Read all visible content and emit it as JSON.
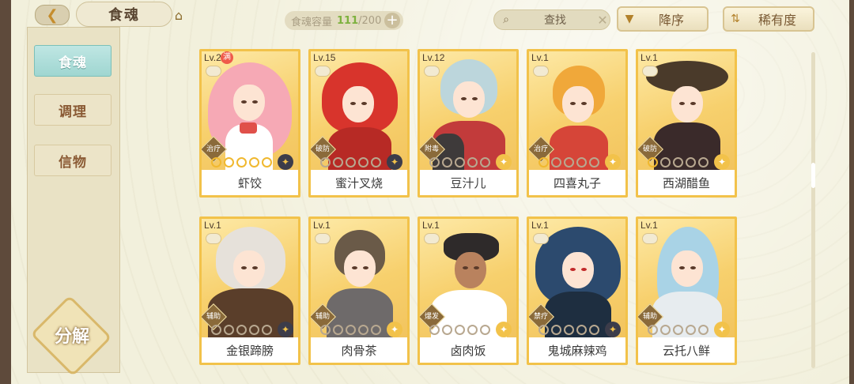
{
  "header": {
    "title": "食魂",
    "capacity_label": "食魂容量",
    "capacity_current": "111",
    "capacity_max": "/200",
    "search_placeholder": "查找",
    "sort_order_label": "降序",
    "sort_rarity_label": "稀有度"
  },
  "sidebar": {
    "tabs": [
      {
        "label": "食魂",
        "active": true
      },
      {
        "label": "调理",
        "active": false
      },
      {
        "label": "信物",
        "active": false
      }
    ],
    "decompose_label": "分解"
  },
  "cards": [
    {
      "level": "Lv.20",
      "name": "虾饺",
      "role": "治疗",
      "stars_on": 5,
      "rarity": "dark",
      "full_badge": "满"
    },
    {
      "level": "Lv.15",
      "name": "蜜汁叉烧",
      "role": "破防",
      "stars_on": 0,
      "rarity": "dark",
      "full_badge": ""
    },
    {
      "level": "Lv.12",
      "name": "豆汁儿",
      "role": "附毒",
      "stars_on": 0,
      "rarity": "gold",
      "full_badge": ""
    },
    {
      "level": "Lv.1",
      "name": "四喜丸子",
      "role": "治疗",
      "stars_on": 1,
      "rarity": "gold",
      "full_badge": ""
    },
    {
      "level": "Lv.1",
      "name": "西湖醋鱼",
      "role": "破防",
      "stars_on": 1,
      "rarity": "gold",
      "full_badge": ""
    },
    {
      "level": "Lv.1",
      "name": "金银蹄膀",
      "role": "辅助",
      "stars_on": 0,
      "rarity": "dark",
      "full_badge": ""
    },
    {
      "level": "Lv.1",
      "name": "肉骨茶",
      "role": "辅助",
      "stars_on": 0,
      "rarity": "gold",
      "full_badge": ""
    },
    {
      "level": "Lv.1",
      "name": "卤肉饭",
      "role": "爆发",
      "stars_on": 0,
      "rarity": "gold",
      "full_badge": ""
    },
    {
      "level": "Lv.1",
      "name": "鬼城麻辣鸡",
      "role": "禁疗",
      "stars_on": 0,
      "rarity": "dark",
      "full_badge": ""
    },
    {
      "level": "Lv.1",
      "name": "云托八鲜",
      "role": "辅助",
      "stars_on": 0,
      "rarity": "gold",
      "full_badge": ""
    }
  ],
  "icons": {
    "back": "back-arrow-icon",
    "home": "home-icon",
    "search": "search-icon",
    "clear": "close-icon",
    "sort_order": "sort-desc-icon",
    "sort_rarity": "sort-rarity-icon"
  }
}
